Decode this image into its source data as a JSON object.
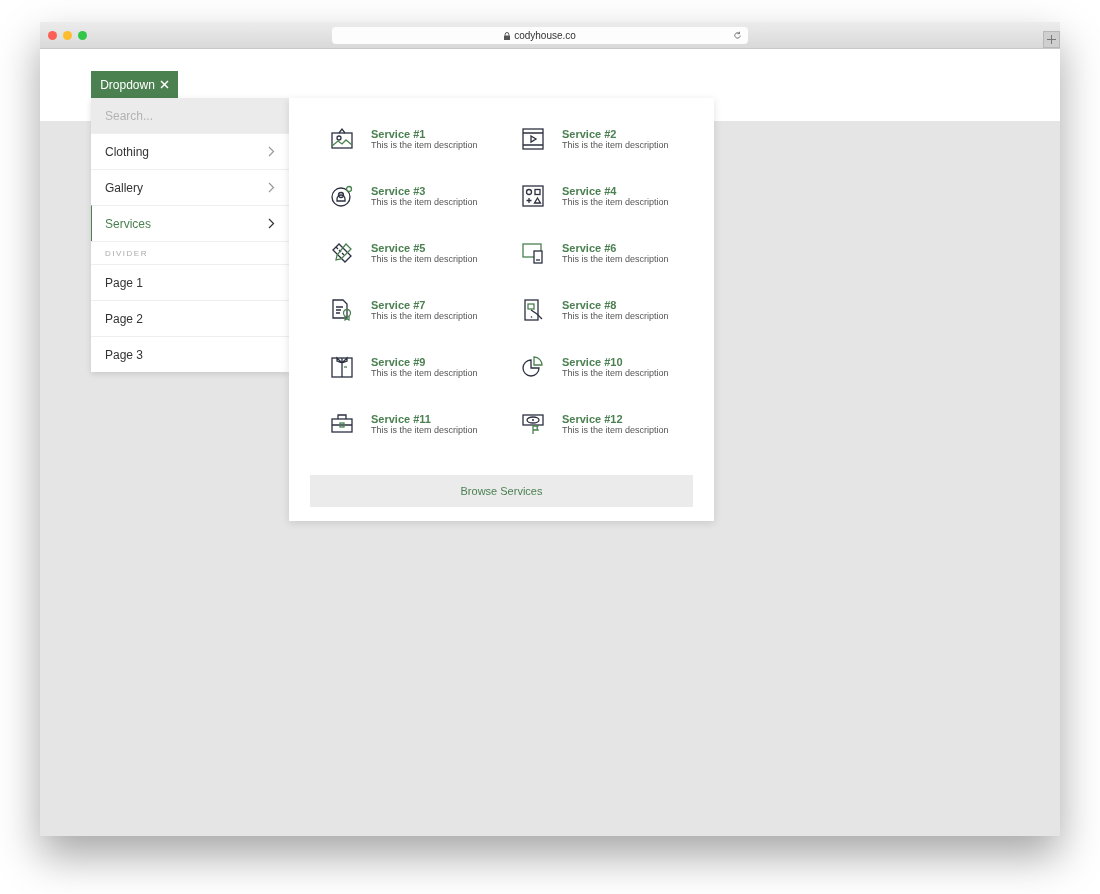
{
  "browser": {
    "url": "codyhouse.co"
  },
  "dropdown_button": {
    "label": "Dropdown",
    "expanded": true
  },
  "menu": {
    "search": {
      "placeholder": "Search..."
    },
    "items": [
      {
        "kind": "submenu",
        "label": "Clothing",
        "selected": false
      },
      {
        "kind": "submenu",
        "label": "Gallery",
        "selected": false
      },
      {
        "kind": "submenu",
        "label": "Services",
        "selected": true
      },
      {
        "kind": "heading",
        "label": "DIVIDER"
      },
      {
        "kind": "link",
        "label": "Page 1",
        "selected": false
      },
      {
        "kind": "link",
        "label": "Page 2",
        "selected": false
      },
      {
        "kind": "link",
        "label": "Page 3",
        "selected": false
      }
    ]
  },
  "services": [
    {
      "title": "Service #1",
      "description": "This is the item description"
    },
    {
      "title": "Service #2",
      "description": "This is the item description"
    },
    {
      "title": "Service #3",
      "description": "This is the item description"
    },
    {
      "title": "Service #4",
      "description": "This is the item description"
    },
    {
      "title": "Service #5",
      "description": "This is the item description"
    },
    {
      "title": "Service #6",
      "description": "This is the item description"
    },
    {
      "title": "Service #7",
      "description": "This is the item description"
    },
    {
      "title": "Service #8",
      "description": "This is the item description"
    },
    {
      "title": "Service #9",
      "description": "This is the item description"
    },
    {
      "title": "Service #10",
      "description": "This is the item description"
    },
    {
      "title": "Service #11",
      "description": "This is the item description"
    },
    {
      "title": "Service #12",
      "description": "This is the item description"
    }
  ],
  "browse_button": {
    "label": "Browse Services"
  }
}
